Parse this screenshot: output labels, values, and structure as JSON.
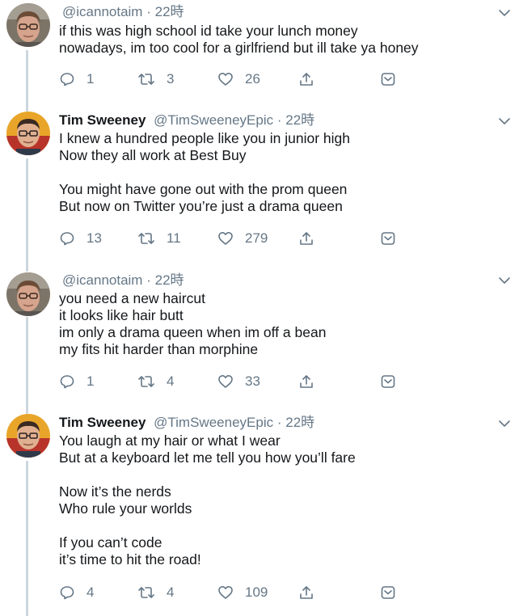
{
  "colors": {
    "text": "#14171a",
    "secondary": "#657786",
    "thread_line": "#ccd6dd"
  },
  "tweets": [
    {
      "name": "",
      "handle": "@icannotaim",
      "separator": "·",
      "time": "22時",
      "avatar": "avatar-icannotaim",
      "text": "if this was high school id take your lunch money\nnowadays, im too cool for a girlfriend but ill take ya honey",
      "replies": "1",
      "retweets": "3",
      "likes": "26"
    },
    {
      "name": "Tim Sweeney",
      "handle": "@TimSweeneyEpic",
      "separator": "·",
      "time": "22時",
      "avatar": "avatar-tim-sweeney",
      "text": "I knew a hundred people like you in junior high\nNow they all work at Best Buy\n\nYou might have gone out with the prom queen\nBut now on Twitter you’re just a drama queen",
      "replies": "13",
      "retweets": "11",
      "likes": "279"
    },
    {
      "name": "",
      "handle": "@icannotaim",
      "separator": "·",
      "time": "22時",
      "avatar": "avatar-icannotaim",
      "text": "you need a new haircut\nit looks like hair butt\nim only a drama queen when im off a bean\nmy fits hit harder than morphine",
      "replies": "1",
      "retweets": "4",
      "likes": "33"
    },
    {
      "name": "Tim Sweeney",
      "handle": "@TimSweeneyEpic",
      "separator": "·",
      "time": "22時",
      "avatar": "avatar-tim-sweeney",
      "text": "You laugh at my hair or what I wear\nBut at a keyboard let me tell you how you’ll fare\n\nNow it’s the nerds\nWho rule your worlds\n\nIf you can’t code\nit’s time to hit the road!",
      "replies": "4",
      "retweets": "4",
      "likes": "109"
    }
  ]
}
